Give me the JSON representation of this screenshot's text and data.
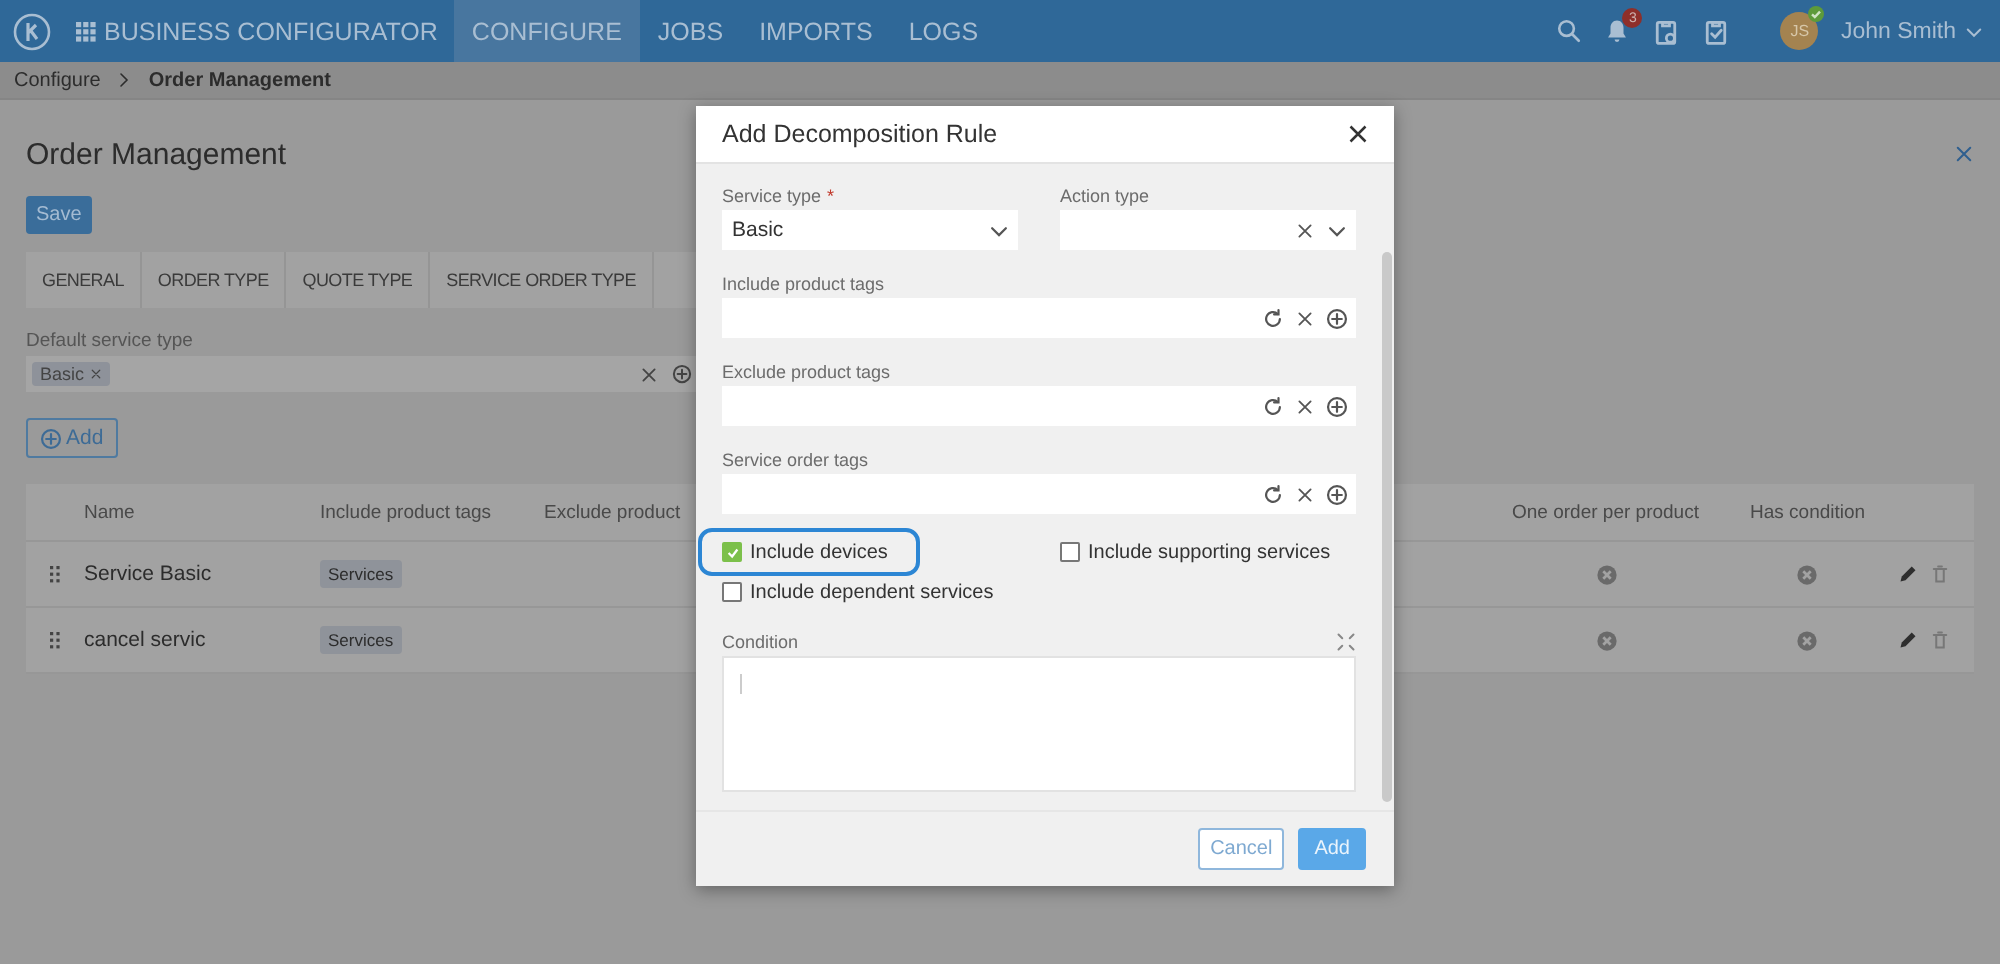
{
  "top_bar": {
    "app_title": "BUSINESS CONFIGURATOR",
    "nav": [
      {
        "label": "CONFIGURE",
        "selected": true
      },
      {
        "label": "JOBS",
        "selected": false
      },
      {
        "label": "IMPORTS",
        "selected": false
      },
      {
        "label": "LOGS",
        "selected": false
      }
    ],
    "notification_count": "3",
    "user": {
      "initials": "JS",
      "name": "John Smith"
    }
  },
  "breadcrumb": [
    "Configure",
    "Order Management"
  ],
  "page": {
    "title": "Order Management",
    "save_button": "Save",
    "tabs": [
      {
        "label": "GENERAL",
        "selected": false
      },
      {
        "label": "ORDER TYPE",
        "selected": false
      },
      {
        "label": "QUOTE TYPE",
        "selected": false
      },
      {
        "label": "SERVICE ORDER TYPE",
        "selected": false
      }
    ],
    "default_service_type": {
      "label": "Default service type",
      "tags": [
        "Basic"
      ]
    },
    "add_button": "Add",
    "table": {
      "columns": [
        "Name",
        "Include product tags",
        "Exclude product",
        "One order per product",
        "Has condition"
      ],
      "rows": [
        {
          "name": "Service Basic",
          "include_tags": [
            "Services"
          ],
          "one_order_per_product": false,
          "has_condition": false
        },
        {
          "name": "cancel servic",
          "include_tags": [
            "Services"
          ],
          "one_order_per_product": false,
          "has_condition": false
        }
      ]
    }
  },
  "dialog": {
    "title": "Add Decomposition Rule",
    "fields": [
      {
        "kind": "select",
        "label": "Service type",
        "required_mark": "*",
        "value": "Basic",
        "clearable": false
      },
      {
        "kind": "select",
        "label": "Action type",
        "clearable": true
      },
      {
        "kind": "tags",
        "label": "Include product tags"
      },
      {
        "kind": "tags",
        "label": "Exclude product tags"
      },
      {
        "kind": "tags",
        "label": "Service order tags"
      }
    ],
    "checkboxes": [
      {
        "label": "Include devices",
        "checked": true,
        "focused": true
      },
      {
        "label": "Include supporting services",
        "checked": false,
        "focused": false
      },
      {
        "label": "Include dependent services",
        "checked": false,
        "focused": false
      }
    ],
    "condition": {
      "label": "Condition"
    },
    "buttons": [
      {
        "label": "Cancel",
        "kind": "secondary"
      },
      {
        "label": "Add",
        "kind": "primary"
      }
    ]
  }
}
